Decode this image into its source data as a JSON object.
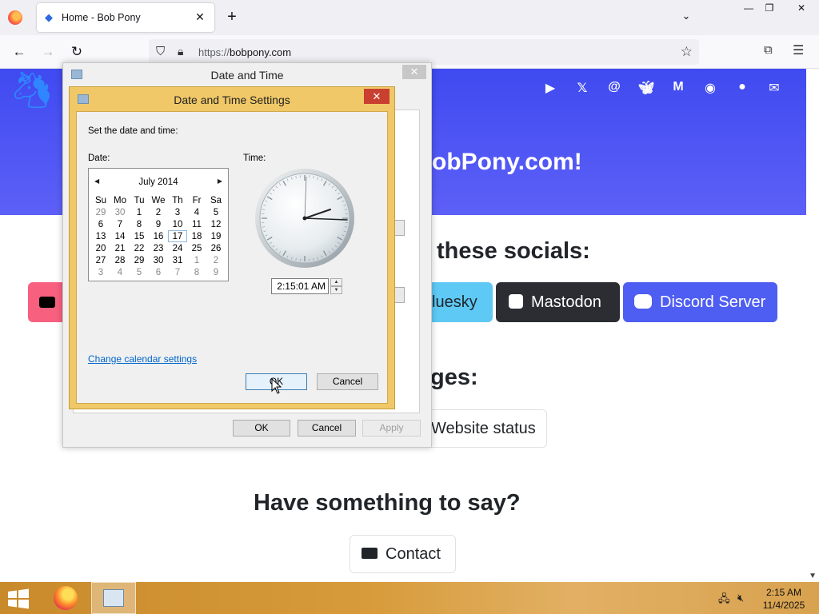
{
  "browser": {
    "tab_title": "Home - Bob Pony",
    "tab_close": "✕",
    "new_tab": "+",
    "url_scheme": "https://",
    "url_host": "bobpony.com",
    "window_controls": {
      "minimize": "—",
      "restore": "❐",
      "close": "✕"
    }
  },
  "page": {
    "hero_title": "obPony.com!",
    "socials_heading": "these socials:",
    "pages_heading": "ges:",
    "say_heading": "Have something to say?",
    "buttons": {
      "bluesky": "luesky",
      "mastodon": "Mastodon",
      "discord": "Discord Server",
      "website_status": "Website status",
      "contact": "Contact"
    },
    "social_icons": [
      "youtube-icon",
      "x-icon",
      "threads-icon",
      "bluesky-icon",
      "mastodon-icon",
      "discord-icon",
      "github-icon",
      "mail-icon"
    ]
  },
  "date_time_dialog": {
    "title": "Date and Time",
    "ok": "OK",
    "cancel": "Cancel",
    "apply": "Apply"
  },
  "settings_dialog": {
    "title": "Date and Time Settings",
    "instruction": "Set the date and time:",
    "date_label": "Date:",
    "time_label": "Time:",
    "month_label": "July 2014",
    "weekdays": [
      "Su",
      "Mo",
      "Tu",
      "We",
      "Th",
      "Fr",
      "Sa"
    ],
    "weeks": [
      [
        "29",
        "30",
        "1",
        "2",
        "3",
        "4",
        "5"
      ],
      [
        "6",
        "7",
        "8",
        "9",
        "10",
        "11",
        "12"
      ],
      [
        "13",
        "14",
        "15",
        "16",
        "17",
        "18",
        "19"
      ],
      [
        "20",
        "21",
        "22",
        "23",
        "24",
        "25",
        "26"
      ],
      [
        "27",
        "28",
        "29",
        "30",
        "31",
        "1",
        "2"
      ],
      [
        "3",
        "4",
        "5",
        "6",
        "7",
        "8",
        "9"
      ]
    ],
    "selected_day": "17",
    "time_value": "2:15:01 AM",
    "calendar_settings_link": "Change calendar settings",
    "ok": "OK",
    "cancel": "Cancel"
  },
  "taskbar": {
    "time": "2:15 AM",
    "date": "11/4/2025"
  },
  "colors": {
    "hero_blue": "#3f4af0",
    "dialog_border_gold": "#f0c868",
    "close_red": "#c94031",
    "link_blue": "#0066cc",
    "mastodon_dark": "#2b2d33",
    "discord_blue": "#4e5df2",
    "bluesky_light": "#5ec9f5",
    "youtube_pink": "#f7607f"
  }
}
